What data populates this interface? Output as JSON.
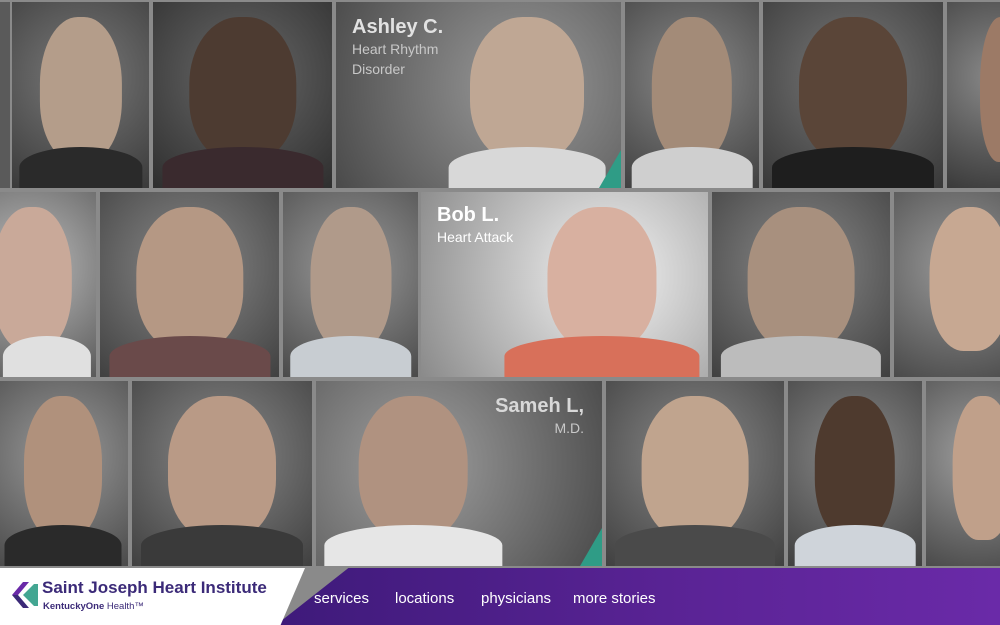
{
  "stories": [
    {
      "name": "Ashley C.",
      "condition_line1": "Heart Rhythm",
      "condition_line2": "Disorder"
    },
    {
      "name": "Bob L.",
      "condition_line1": "Heart Attack"
    },
    {
      "name": "Sameh L,",
      "condition_line1": "M.D."
    }
  ],
  "brand": {
    "name": "Saint Joseph Heart Institute",
    "sub_bold": "KentuckyOne",
    "sub_rest": " Health™"
  },
  "nav": [
    {
      "label": "services"
    },
    {
      "label": "locations"
    },
    {
      "label": "physicians"
    },
    {
      "label": "more stories"
    }
  ],
  "colors": {
    "accent_teal": "#2f9c86",
    "footer_purple": "#5c2497",
    "brand_text": "#3b2a78"
  }
}
